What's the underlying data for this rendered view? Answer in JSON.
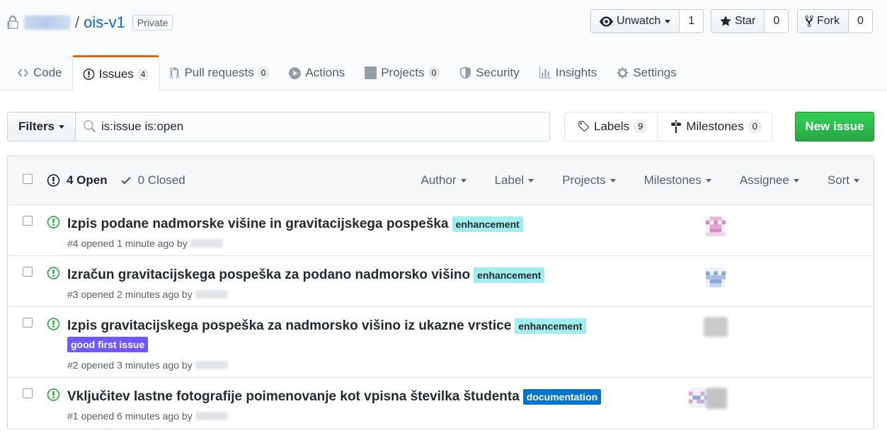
{
  "repo": {
    "owner_icon": "lock-icon",
    "separator": "/",
    "name": "ois-v1",
    "visibility": "Private"
  },
  "actions": {
    "watch": {
      "label": "Unwatch",
      "count": "1",
      "icon": "eye-icon"
    },
    "star": {
      "label": "Star",
      "count": "0",
      "icon": "star-icon"
    },
    "fork": {
      "label": "Fork",
      "count": "0",
      "icon": "fork-icon"
    }
  },
  "tabs": [
    {
      "label": "Code",
      "icon": "code-icon"
    },
    {
      "label": "Issues",
      "counter": "4",
      "icon": "issue-opened-icon",
      "selected": true
    },
    {
      "label": "Pull requests",
      "counter": "0",
      "icon": "pull-request-icon"
    },
    {
      "label": "Actions",
      "icon": "play-icon"
    },
    {
      "label": "Projects",
      "counter": "0",
      "icon": "project-icon"
    },
    {
      "label": "Security",
      "icon": "shield-icon"
    },
    {
      "label": "Insights",
      "icon": "graph-icon"
    },
    {
      "label": "Settings",
      "icon": "gear-icon"
    }
  ],
  "subnav": {
    "filters_label": "Filters",
    "search_value": "is:issue is:open",
    "labels_label": "Labels",
    "labels_count": "9",
    "milestones_label": "Milestones",
    "milestones_count": "0",
    "new_issue_label": "New issue"
  },
  "list_header": {
    "open_label": "4 Open",
    "closed_label": "0 Closed",
    "sorts": [
      "Author",
      "Label",
      "Projects",
      "Milestones",
      "Assignee",
      "Sort"
    ]
  },
  "issues": [
    {
      "title": "Izpis podane nadmorske višine in gravitacijskega pospeška",
      "labels": [
        "enhancement"
      ],
      "meta": "#4 opened 1 minute ago by"
    },
    {
      "title": "Izračun gravitacijskega pospeška za podano nadmorsko višino",
      "labels": [
        "enhancement"
      ],
      "meta": "#3 opened 2 minutes ago by"
    },
    {
      "title": "Izpis gravitacijskega pospeška za nadmorsko višino iz ukazne vrstice",
      "labels": [
        "enhancement",
        "good first issue"
      ],
      "meta": "#2 opened 3 minutes ago by"
    },
    {
      "title": "Vključitev lastne fotografije poimenovanje kot vpisna številka študenta",
      "labels": [
        "documentation"
      ],
      "meta": "#1 opened 6 minutes ago by"
    }
  ],
  "colors": {
    "accent_tab": "#e36209",
    "link": "#0366d6",
    "open_green": "#28a745",
    "label_enhancement": "#a2eeef",
    "label_documentation": "#0075ca",
    "label_good_first_issue": "#7057ff"
  }
}
